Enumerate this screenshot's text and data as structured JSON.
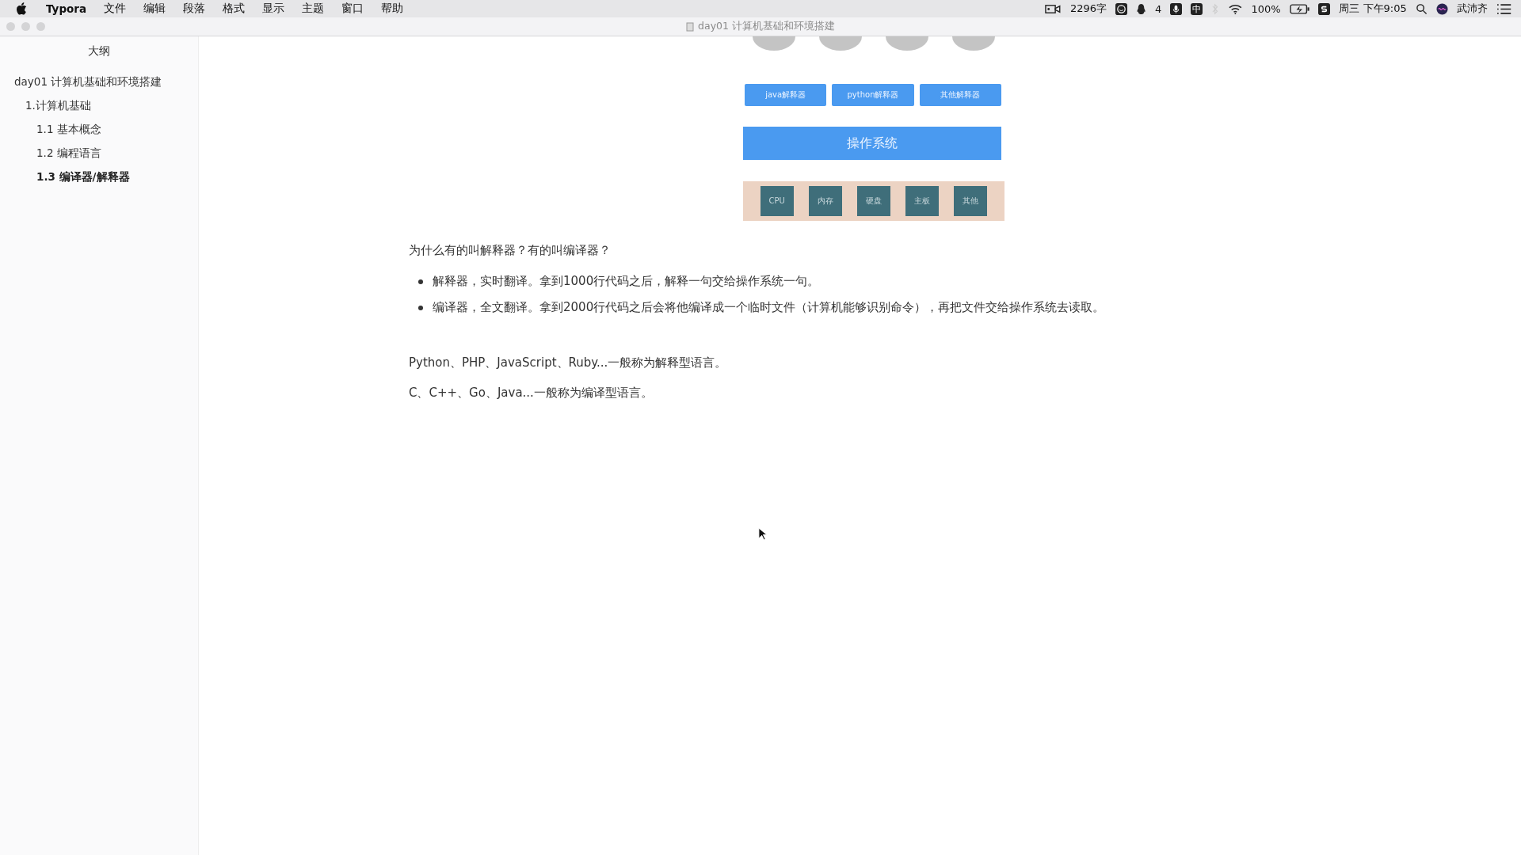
{
  "menu_bar": {
    "app": "Typora",
    "menus": [
      "文件",
      "编辑",
      "段落",
      "格式",
      "显示",
      "主题",
      "窗口",
      "帮助"
    ],
    "status": {
      "word_count": "2296字",
      "notifications": "4",
      "input_method": "中",
      "battery": "100%",
      "clock": "周三 下午9:05",
      "user": "武沛齐"
    }
  },
  "window": {
    "title": "day01 计算机基础和环境搭建"
  },
  "sidebar": {
    "title": "大纲",
    "items": [
      {
        "label": "day01 计算机基础和环境搭建",
        "selected": false,
        "children": [
          {
            "label": "1.计算机基础",
            "selected": false,
            "children": [
              {
                "label": "1.1 基本概念",
                "selected": false
              },
              {
                "label": "1.2 编程语言",
                "selected": false
              },
              {
                "label": "1.3 编译器/解释器",
                "selected": true
              }
            ]
          }
        ]
      }
    ]
  },
  "document": {
    "diagram": {
      "interpreters": [
        "java解释器",
        "python解释器",
        "其他解释器"
      ],
      "os": "操作系统",
      "hardware": [
        "CPU",
        "内存",
        "硬盘",
        "主板",
        "其他"
      ]
    },
    "blocks": [
      {
        "kind": "paragraph",
        "text": "为什么有的叫解释器？有的叫编译器？"
      },
      {
        "kind": "list",
        "items": [
          "解释器，实时翻译。拿到1000行代码之后，解释一句交给操作系统一句。",
          "编译器，全文翻译。拿到2000行代码之后会将他编译成一个临时文件（计算机能够识别命令），再把文件交给操作系统去读取。"
        ]
      },
      {
        "kind": "paragraph",
        "text": "Python、PHP、JavaScript、Ruby...一般称为解释型语言。"
      },
      {
        "kind": "paragraph",
        "text": "C、C++、Go、Java...一般称为编译型语言。"
      }
    ]
  }
}
